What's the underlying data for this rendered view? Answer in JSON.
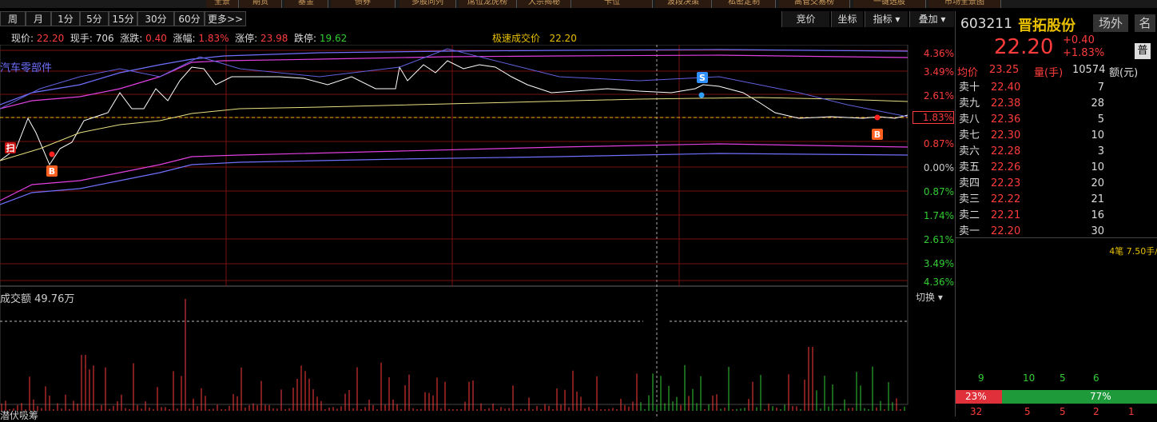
{
  "toolbar": {
    "items": [
      "全景",
      "期货",
      "基金",
      "债券",
      "多股同列",
      "席位龙虎榜",
      "大宗揭秘",
      "卡位",
      "波段决策",
      "私密定制",
      "高管交易榜",
      "一键选股",
      "市场全景图"
    ]
  },
  "period_tabs": [
    "周",
    "月",
    "1分",
    "5分",
    "15分",
    "30分",
    "60分",
    "更多>>"
  ],
  "right_tabs": [
    "竞价",
    "坐标",
    "指标 ▾",
    "叠加 ▾"
  ],
  "info": {
    "price_label": "现价:",
    "price": "22.20",
    "hand_label": "现手:",
    "hand": "706",
    "change_label": "涨跌:",
    "change": "0.40",
    "pct_label": "涨幅:",
    "pct": "1.83%",
    "limit_up_label": "涨停:",
    "limit_up": "23.98",
    "limit_down_label": "跌停:",
    "limit_down": "19.62",
    "fast_label": "极速成交价",
    "fast_price": "22.20"
  },
  "sector_label": "汽车零部件",
  "volume_label": "成交额 49.76万",
  "switch_label": "切换 ▾",
  "bottom_label": "潜伏吸筹",
  "stock": {
    "code": "603211",
    "name": "晋拓股份",
    "tag1": "场外",
    "tag2": "名",
    "price": "22.20",
    "change": "+0.40",
    "pct": "+1.83%",
    "badge": "普",
    "avg_label": "均价",
    "avg": "23.25",
    "vol_label": "量(手)",
    "vol": "10574",
    "amt_label": "额(元)"
  },
  "asks": [
    {
      "name": "卖十",
      "price": "22.40",
      "vol": "7"
    },
    {
      "name": "卖九",
      "price": "22.38",
      "vol": "28"
    },
    {
      "name": "卖八",
      "price": "22.36",
      "vol": "5"
    },
    {
      "name": "卖七",
      "price": "22.30",
      "vol": "10"
    },
    {
      "name": "卖六",
      "price": "22.28",
      "vol": "3"
    },
    {
      "name": "卖五",
      "price": "22.26",
      "vol": "10"
    },
    {
      "name": "卖四",
      "price": "22.23",
      "vol": "20"
    },
    {
      "name": "卖三",
      "price": "22.22",
      "vol": "21"
    },
    {
      "name": "卖二",
      "price": "22.21",
      "vol": "16"
    },
    {
      "name": "卖一",
      "price": "22.20",
      "vol": "30"
    }
  ],
  "trade_note": "4笔 7.50手/",
  "flow_numbers": [
    "9",
    "10",
    "5",
    "6"
  ],
  "ratio": {
    "left": "23%",
    "right": "77%",
    "left_value": 0.23
  },
  "bottom_numbers": [
    "32",
    "5",
    "5",
    "2",
    "1"
  ],
  "pct_axis": [
    {
      "text": "4.36%",
      "color": "#ff3c3c"
    },
    {
      "text": "3.49%",
      "color": "#ff3c3c"
    },
    {
      "text": "2.61%",
      "color": "#ff3c3c"
    },
    {
      "text": "1.83%",
      "color": "#ff3c3c"
    },
    {
      "text": "0.87%",
      "color": "#ff3c3c"
    },
    {
      "text": "0.00%",
      "color": "#cccccc"
    },
    {
      "text": "0.87%",
      "color": "#33cc33"
    },
    {
      "text": "1.74%",
      "color": "#33cc33"
    },
    {
      "text": "2.61%",
      "color": "#33cc33"
    },
    {
      "text": "3.49%",
      "color": "#33cc33"
    },
    {
      "text": "4.36%",
      "color": "#33cc33"
    }
  ],
  "markers": {
    "sweep": "扫",
    "buy": "B",
    "sell": "S"
  },
  "colors": {
    "up": "#ff3c3c",
    "down": "#33cc33",
    "avg_line": "#e8e080",
    "price_line": "#ffffff",
    "band_magenta": "#e040e0",
    "band_blue": "#7070ff",
    "accent": "#e8c000"
  }
}
